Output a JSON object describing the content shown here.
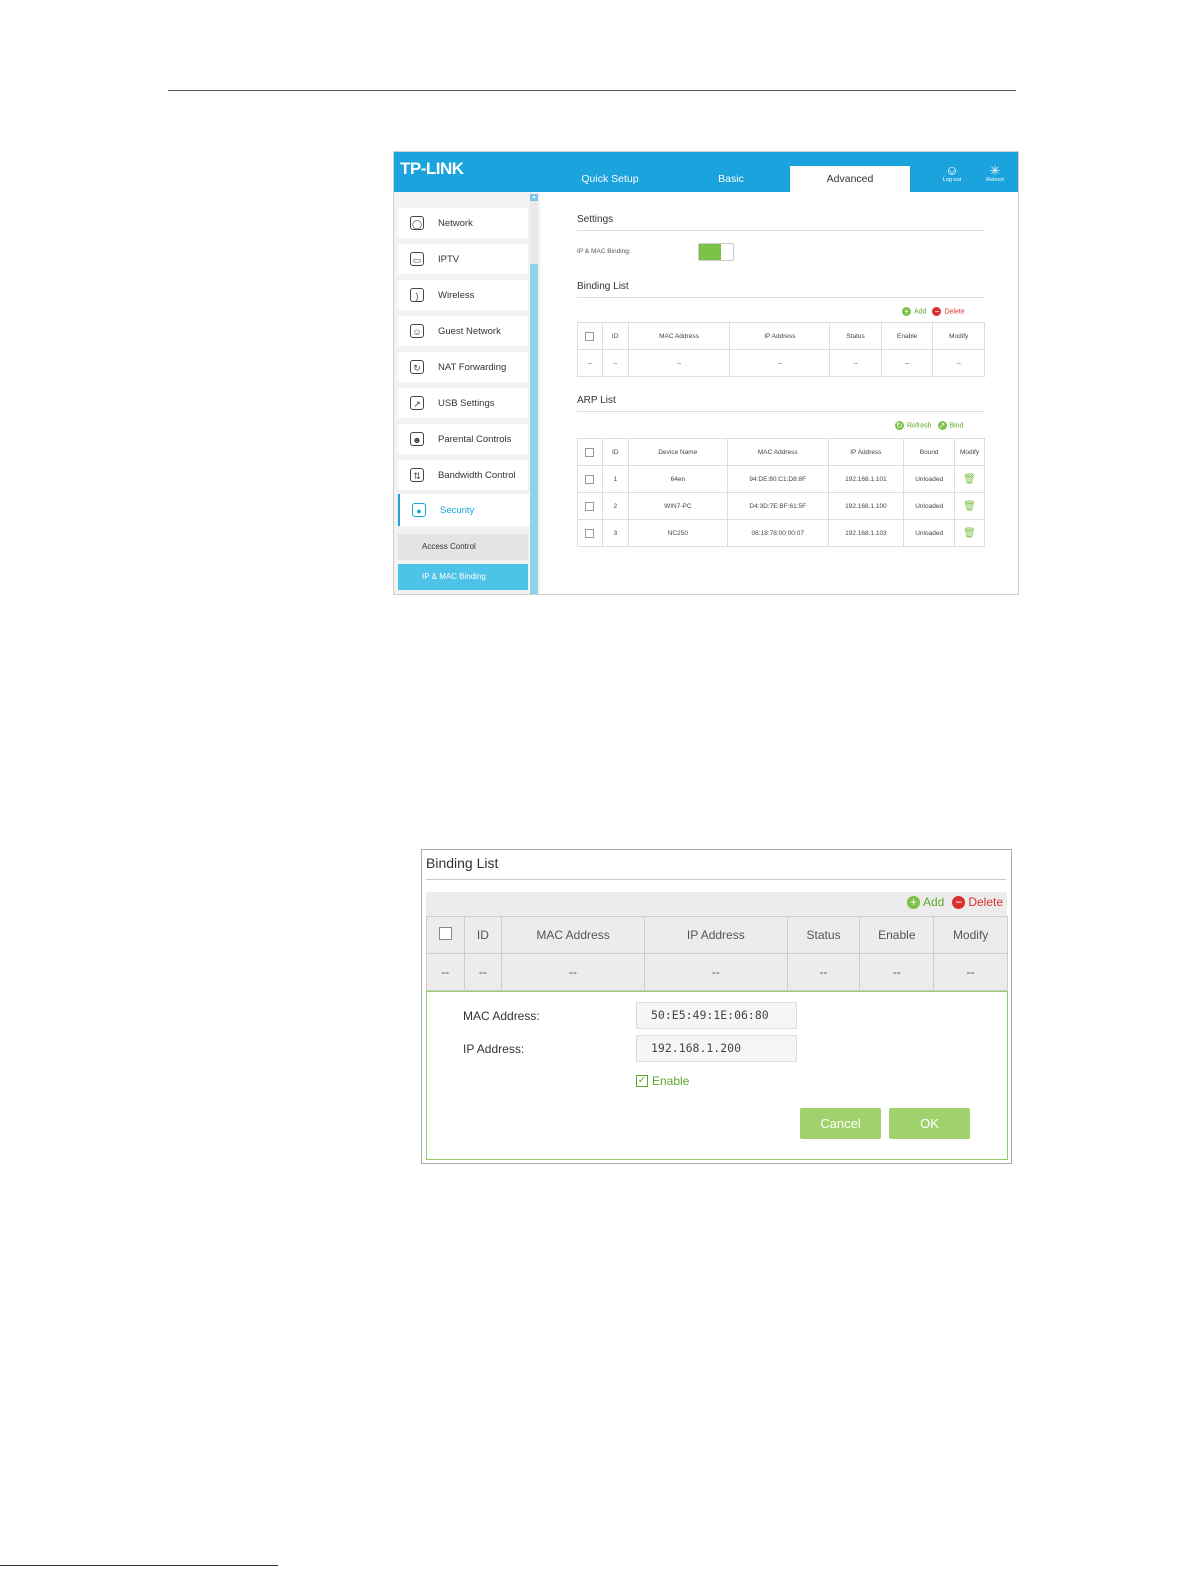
{
  "shot1": {
    "logo": "TP-LINK",
    "tabs": {
      "quick_setup": "Quick Setup",
      "basic": "Basic",
      "advanced": "Advanced"
    },
    "top_icons": {
      "logout": "Log out",
      "reboot": "Reboot"
    },
    "sidebar": {
      "network": "Network",
      "iptv": "IPTV",
      "wireless": "Wireless",
      "guest": "Guest Network",
      "nat": "NAT Forwarding",
      "usb": "USB Settings",
      "parental": "Parental Controls",
      "bandwidth": "Bandwidth Control",
      "security": "Security",
      "access_control": "Access Control",
      "ip_mac_binding": "IP & MAC Binding"
    },
    "settings": {
      "title": "Settings",
      "label": "IP & MAC Binding:",
      "toggle": "on"
    },
    "binding": {
      "title": "Binding List",
      "add": "Add",
      "delete": "Delete",
      "headers": {
        "id": "ID",
        "mac": "MAC Address",
        "ip": "IP Address",
        "status": "Status",
        "enable": "Enable",
        "modify": "Modify"
      },
      "empty": "--"
    },
    "arp": {
      "title": "ARP List",
      "refresh": "Refresh",
      "bind": "Bind",
      "headers": {
        "id": "ID",
        "device": "Device Name",
        "mac": "MAC Address",
        "ip": "IP Address",
        "bound": "Bound",
        "modify": "Modify"
      },
      "rows": [
        {
          "id": "1",
          "device": "64en",
          "mac": "94:DE:80:C1:D8:8F",
          "ip": "192.168.1.101",
          "bound": "Unloaded"
        },
        {
          "id": "2",
          "device": "WIN7-PC",
          "mac": "D4:3D:7E:BF:61:5F",
          "ip": "192.168.1.100",
          "bound": "Unloaded"
        },
        {
          "id": "3",
          "device": "NC250",
          "mac": "06:18:78:00:00:07",
          "ip": "192.168.1.103",
          "bound": "Unloaded"
        }
      ]
    }
  },
  "shot2": {
    "title": "Binding List",
    "add": "Add",
    "delete": "Delete",
    "headers": {
      "id": "ID",
      "mac": "MAC Address",
      "ip": "IP Address",
      "status": "Status",
      "enable": "Enable",
      "modify": "Modify"
    },
    "empty": "--",
    "form": {
      "mac_label": "MAC Address:",
      "mac_value": "50:E5:49:1E:06:80",
      "ip_label": "IP Address:",
      "ip_value": "192.168.1.200",
      "enable_label": "Enable",
      "enable_checked": true,
      "cancel": "Cancel",
      "ok": "OK"
    }
  }
}
